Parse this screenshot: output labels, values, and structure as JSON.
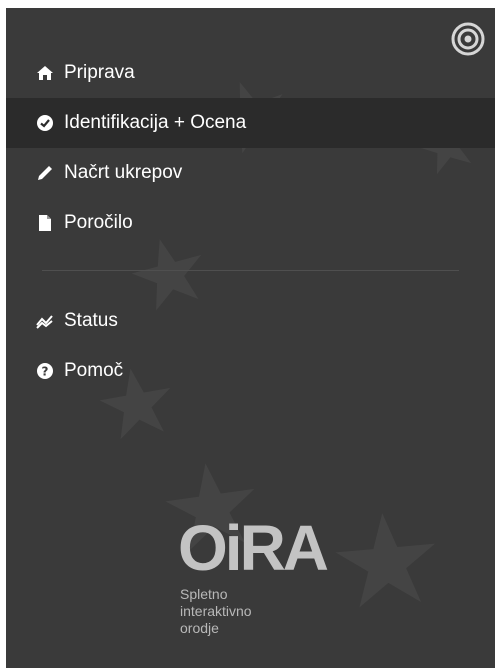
{
  "nav": {
    "items": [
      {
        "label": "Priprava",
        "icon": "home-icon"
      },
      {
        "label": "Identifikacija + Ocena",
        "icon": "check-circle-icon",
        "active": true
      },
      {
        "label": "Načrt ukrepov",
        "icon": "pencil-icon"
      },
      {
        "label": "Poročilo",
        "icon": "document-icon"
      }
    ],
    "secondary": [
      {
        "label": "Status",
        "icon": "trend-icon"
      },
      {
        "label": "Pomoč",
        "icon": "help-circle-icon"
      }
    ]
  },
  "logo": {
    "word": "OiRA",
    "subtitle_lines": [
      "Spletno",
      "interaktivno",
      "orodje"
    ]
  },
  "colors": {
    "panel_bg": "#3a3a3a",
    "active_bg": "#2b2b2b",
    "text": "#ffffff",
    "logo": "#c3c3c3"
  }
}
